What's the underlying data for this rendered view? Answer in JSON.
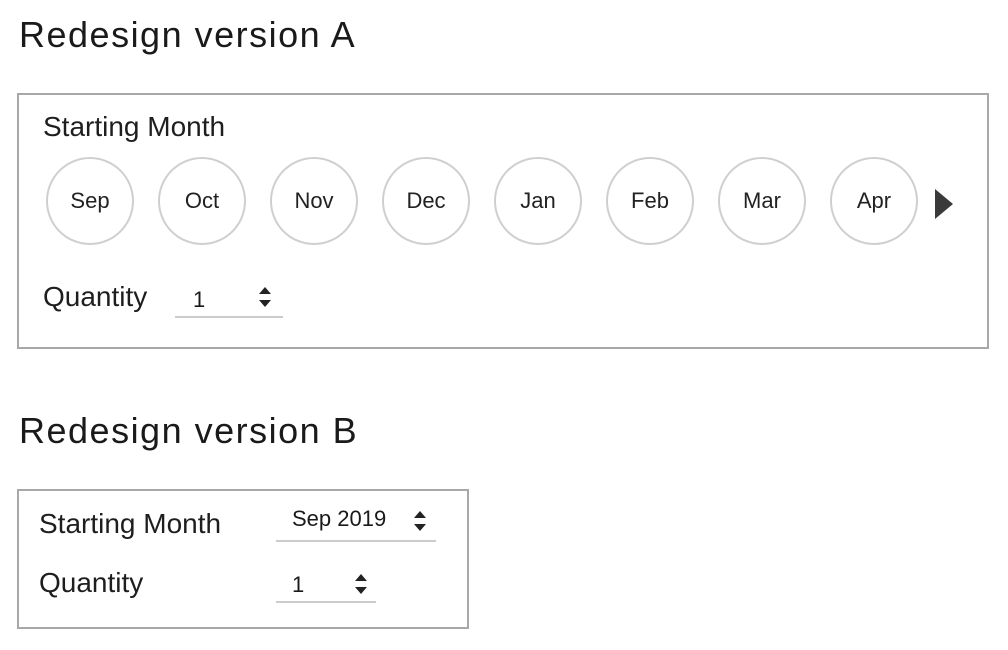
{
  "version_a": {
    "title": "Redesign version A",
    "starting_month_label": "Starting Month",
    "months": [
      "Sep",
      "Oct",
      "Nov",
      "Dec",
      "Jan",
      "Feb",
      "Mar",
      "Apr"
    ],
    "next_icon": "triangle-right-icon",
    "quantity_label": "Quantity",
    "quantity_value": "1",
    "stepper_icon": "up-down-stepper-icon"
  },
  "version_b": {
    "title": "Redesign version B",
    "starting_month_label": "Starting Month",
    "starting_month_value": "Sep 2019",
    "quantity_label": "Quantity",
    "quantity_value": "1",
    "stepper_icon": "up-down-stepper-icon"
  },
  "colors": {
    "panel_border": "#a8a8a8",
    "circle_border": "#cfcfcf",
    "underline": "#cccccc",
    "text": "#1a1a1a",
    "arrow": "#3a3a3a"
  }
}
